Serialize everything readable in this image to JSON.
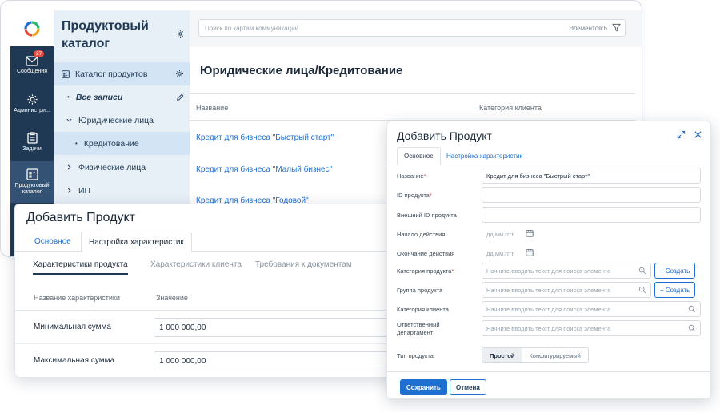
{
  "rail": {
    "items": [
      {
        "label": "Сообщения",
        "badge": "27"
      },
      {
        "label": "Администри..."
      },
      {
        "label": "Задачи"
      },
      {
        "label": "Продуктовый каталог"
      }
    ]
  },
  "catalog": {
    "title": "Продуктовый каталог",
    "items": [
      {
        "label": "Каталог продуктов"
      },
      {
        "label": "Все записи"
      },
      {
        "label": "Юридические лица"
      },
      {
        "label": "Кредитование"
      },
      {
        "label": "Физические лица"
      },
      {
        "label": "ИП"
      }
    ]
  },
  "content": {
    "search_placeholder": "Поиск по картам коммуникаций",
    "count": "Элементов:6",
    "page_title": "Юридические лица/Кредитование",
    "columns": [
      "Название",
      "Категория клиента"
    ],
    "rows": [
      "Кредит для бизнеса \"Быстрый старт\"",
      "Кредит для бизнеса \"Малый бизнес\"",
      "Кредит для бизнеса \"Годовой\""
    ]
  },
  "dialog_left": {
    "title": "Добавить Продукт",
    "tabs": [
      "Основное",
      "Настройка характеристик"
    ],
    "subtabs": [
      "Характеристики продукта",
      "Характеристики клиента",
      "Требования к документам"
    ],
    "columns": [
      "Название характеристики",
      "Значение"
    ],
    "params": [
      {
        "name": "Минимальная сумма",
        "value": "1 000 000,00"
      },
      {
        "name": "Максимальная сумма",
        "value": "1 000 000,00"
      }
    ]
  },
  "dialog_right": {
    "title": "Добавить Продукт",
    "tabs": [
      "Основное",
      "Настройка характеристик"
    ],
    "fields": {
      "name_label": "Название",
      "name_value": "Кредит для бизнеса \"Быстрый старт\"",
      "id_label": "ID продукта",
      "ext_id_label": "Внешний ID продукта",
      "start_label": "Начало действия",
      "end_label": "Окончание действия",
      "date_placeholder": "дд.мм.гггг",
      "category_label": "Категория продукта",
      "group_label": "Группа продукта",
      "client_cat_label": "Категория клиента",
      "dept_label": "Ответственный департамент",
      "search_placeholder": "Начните вводить текст для поиска элемента",
      "create_label": "+ Создать",
      "type_label": "Тип продукта",
      "type_options": [
        "Простой",
        "Конфигурируемый"
      ]
    },
    "save_label": "Сохранить",
    "cancel_label": "Отмена"
  },
  "colors": {
    "rail": "#1f3954",
    "accent": "#1f6fd1",
    "panel": "#e7eff7",
    "required": "#e84a3c"
  }
}
